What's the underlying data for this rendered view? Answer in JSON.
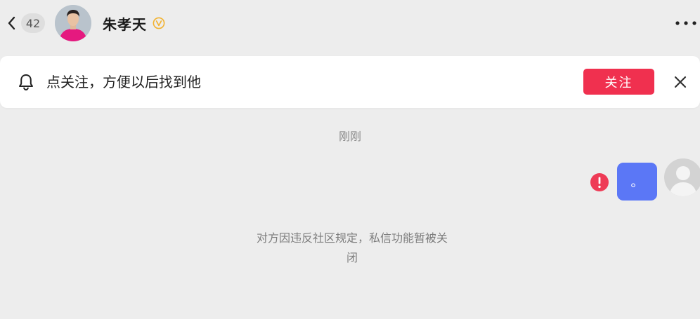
{
  "header": {
    "unread_count": "42",
    "contact_name": "朱孝天"
  },
  "banner": {
    "text": "点关注，方便以后找到他",
    "follow_label": "关注"
  },
  "chat": {
    "timestamp": "刚刚",
    "messages": [
      {
        "sender": "me",
        "text": "。",
        "send_failed": true
      }
    ],
    "system_notice_line1": "对方因违反社区规定，私信功能暂被关",
    "system_notice_line2": "闭"
  },
  "colors": {
    "background": "#ededed",
    "follow_button": "#f0304f",
    "my_bubble": "#5b77f6",
    "error": "#ee3b56",
    "verified": "#f2b230"
  },
  "icons": [
    "back-arrow-icon",
    "verified-icon",
    "more-icon",
    "bell-icon",
    "close-icon",
    "error-icon",
    "default-avatar-icon"
  ]
}
